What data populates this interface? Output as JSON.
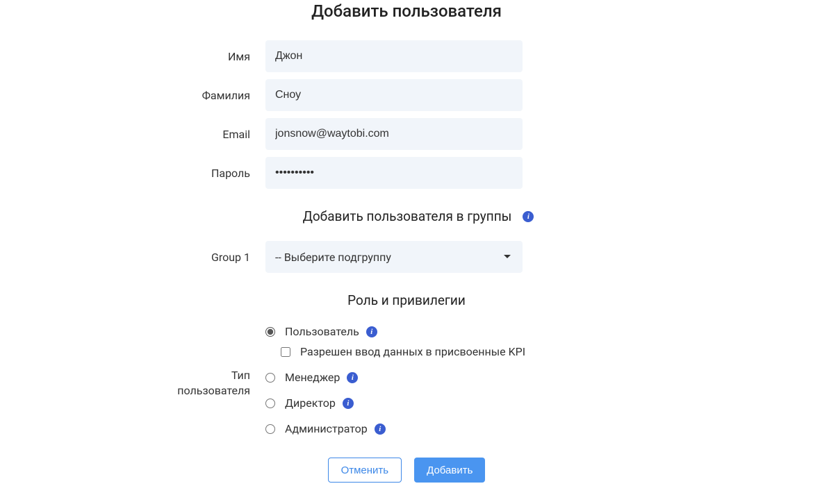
{
  "title": "Добавить пользователя",
  "fields": {
    "first_name": {
      "label": "Имя",
      "value": "Джон"
    },
    "last_name": {
      "label": "Фамилия",
      "value": "Сноу"
    },
    "email": {
      "label": "Email",
      "value": "jonsnow@waytobi.com"
    },
    "password": {
      "label": "Пароль",
      "value": "••••••••••"
    }
  },
  "groups": {
    "header": "Добавить пользователя в группы",
    "row_label": "Group 1",
    "select_placeholder": "-- Выберите подгруппу"
  },
  "roles": {
    "header": "Роль и привилегии",
    "label_line1": "Тип",
    "label_line2": "пользователя",
    "options": {
      "user": {
        "label": "Пользователь",
        "checked": true
      },
      "user_kpi_checkbox": {
        "label": "Разрешен ввод данных в присвоенные KPI",
        "checked": false
      },
      "manager": {
        "label": "Менеджер",
        "checked": false
      },
      "director": {
        "label": "Директор",
        "checked": false
      },
      "admin": {
        "label": "Администратор",
        "checked": false
      }
    }
  },
  "buttons": {
    "cancel": "Отменить",
    "submit": "Добавить"
  },
  "info_glyph": "i"
}
